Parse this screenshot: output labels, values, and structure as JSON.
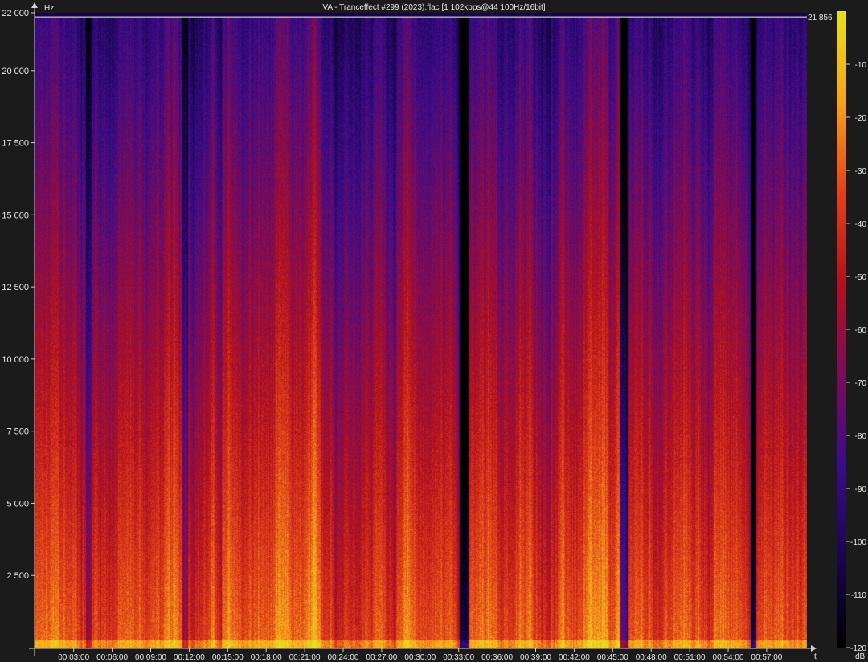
{
  "chart_data": {
    "type": "heatmap",
    "title": "VA - Tranceffect #299 (2023).flac [1 102kbps@44 100Hz/16bit]",
    "ylabel": "Hz",
    "xlabel": "t",
    "colorbar_label": "dB",
    "cutoff_label": "21 856",
    "cutoff_hz": 21856,
    "ylim": [
      0,
      22000
    ],
    "y_ticks": [
      {
        "value": 2500,
        "label": "2 500"
      },
      {
        "value": 5000,
        "label": "5 000"
      },
      {
        "value": 7500,
        "label": "7 500"
      },
      {
        "value": 10000,
        "label": "10 000"
      },
      {
        "value": 12500,
        "label": "12 500"
      },
      {
        "value": 15000,
        "label": "15 000"
      },
      {
        "value": 17500,
        "label": "17 500"
      },
      {
        "value": 20000,
        "label": "20 000"
      },
      {
        "value": 22000,
        "label": "22 000"
      }
    ],
    "x_ticks": [
      "00:03:00",
      "00:06:00",
      "00:09:00",
      "00:12:00",
      "00:15:00",
      "00:18:00",
      "00:21:00",
      "00:24:00",
      "00:27:00",
      "00:30:00",
      "00:33:00",
      "00:36:00",
      "00:39:00",
      "00:42:00",
      "00:45:00",
      "00:48:00",
      "00:51:00",
      "00:54:00",
      "00:57:00"
    ],
    "colorbar_ticks": [
      "-10",
      "-20",
      "-30",
      "-40",
      "-50",
      "-60",
      "-70",
      "-80",
      "-90",
      "-100",
      "-110",
      "-120"
    ],
    "colorbar_range": [
      -120,
      0
    ],
    "colormap": [
      "#000000",
      "#1a0550",
      "#3a0c8a",
      "#7a0c5a",
      "#b3111d",
      "#e2411a",
      "#f6a21c",
      "#e7e01c"
    ],
    "legend_position": "right",
    "grid": false
  }
}
